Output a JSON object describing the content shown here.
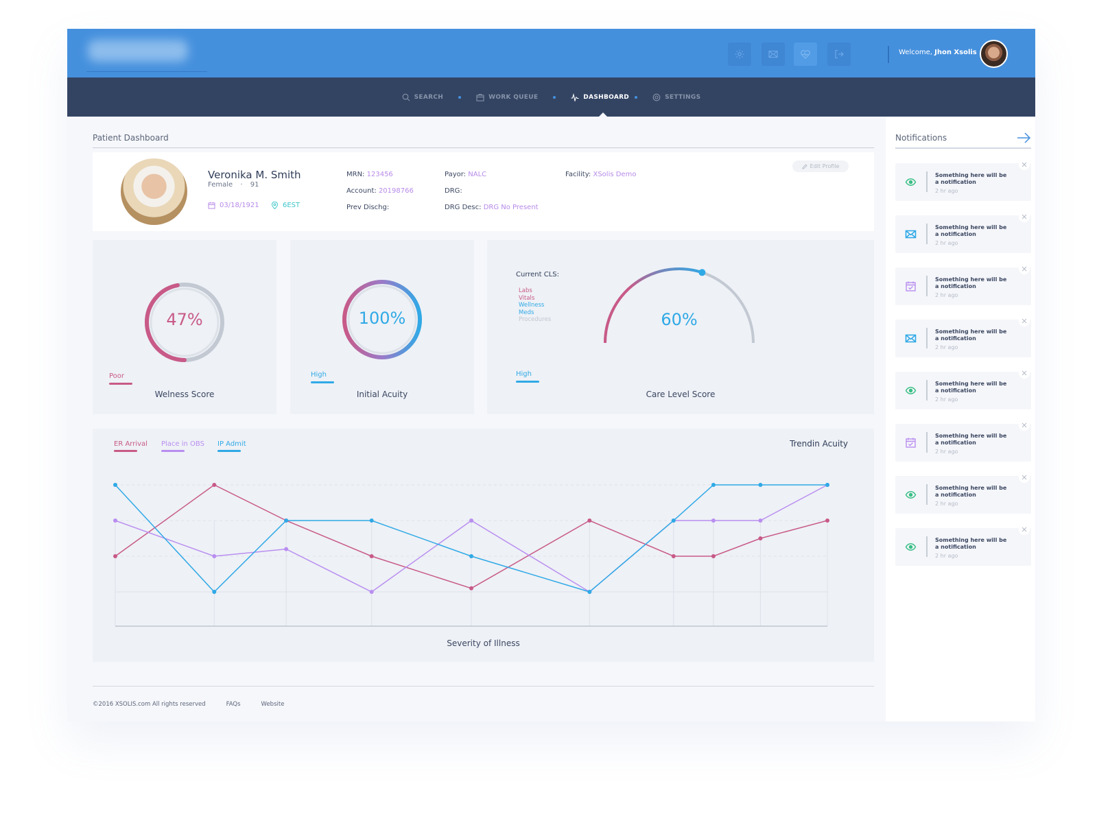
{
  "header": {
    "welcome_prefix": "Welcome, ",
    "user_name": "Jhon Xsolis",
    "icons": [
      "gear-icon",
      "mail-icon",
      "heart-pulse-icon",
      "logout-icon"
    ]
  },
  "nav": {
    "items": [
      {
        "label": "SEARCH",
        "icon": "search-icon",
        "active": false
      },
      {
        "label": "WORK QUEUE",
        "icon": "briefcase-icon",
        "active": false
      },
      {
        "label": "DASHBOARD",
        "icon": "pulse-icon",
        "active": true
      },
      {
        "label": "SETTINGS",
        "icon": "gear-icon",
        "active": false
      }
    ]
  },
  "page": {
    "title": "Patient Dashboard"
  },
  "patient": {
    "name": "Veronika M. Smith",
    "gender": "Female",
    "age": "91",
    "dob": "03/18/1921",
    "location": "6EST",
    "edit_label": "Edit Profile",
    "fields": [
      {
        "label": "MRN:",
        "value": "123456"
      },
      {
        "label": "Account:",
        "value": "20198766"
      },
      {
        "label": "Prev Dischg:",
        "value": ""
      },
      {
        "label": "Payor:",
        "value": "NALC"
      },
      {
        "label": "DRG:",
        "value": ""
      },
      {
        "label": "DRG Desc:",
        "value": "DRG No Present"
      },
      {
        "label": "Facility:",
        "value": "XSolis Demo"
      }
    ]
  },
  "scores": {
    "wellness": {
      "value_text": "47%",
      "fraction": 0.47,
      "level": "Poor",
      "label": "Welness Score"
    },
    "acuity": {
      "value_text": "100%",
      "fraction": 1.0,
      "level": "High",
      "label": "Initial Acuity"
    },
    "care": {
      "value_text": "60%",
      "fraction": 0.6,
      "level": "High",
      "label": "Care Level Score",
      "cls_title": "Current CLS:",
      "cls_items": [
        {
          "label": "Labs",
          "color": "#c85a88"
        },
        {
          "label": "Vitals",
          "color": "#c85a88"
        },
        {
          "label": "Wellness",
          "color": "#2fa9e6"
        },
        {
          "label": "Meds",
          "color": "#2fa9e6"
        },
        {
          "label": "Procedures",
          "color": "#c1c6cf"
        }
      ]
    }
  },
  "colors": {
    "pink": "#c85a88",
    "purple": "#b98ef0",
    "blue": "#2fa9e6",
    "header_blue": "#4590dd",
    "nav_dark": "#334463",
    "green": "#3bbf86"
  },
  "chart_data": {
    "type": "line",
    "title": "Trendin Acuity",
    "xlabel": "Severity of Illness",
    "ylabel": "",
    "x": [
      0,
      1,
      2,
      3,
      4,
      5,
      6,
      7,
      8,
      9
    ],
    "ylim": [
      0,
      4
    ],
    "grid": true,
    "legend": "top-left",
    "series": [
      {
        "name": "ER Arrival",
        "color": "#c85a88",
        "values": [
          2,
          4,
          3,
          2,
          1.1,
          3,
          2,
          2,
          2.5,
          3
        ]
      },
      {
        "name": "Place in OBS",
        "color": "#b98ef0",
        "values": [
          3,
          2,
          2.2,
          1,
          3,
          1,
          3,
          3,
          3,
          4
        ]
      },
      {
        "name": "IP Admit",
        "color": "#2fa9e6",
        "values": [
          4,
          1,
          3,
          3,
          2,
          1,
          3,
          4,
          4,
          4
        ]
      }
    ],
    "x_positions": [
      0,
      0.139,
      0.24,
      0.36,
      0.5,
      0.666,
      0.784,
      0.84,
      0.906,
      1.0
    ]
  },
  "notifications": {
    "title": "Notifications",
    "items": [
      {
        "icon": "eye-icon",
        "text": "Something here will be a notification",
        "time": "2 hr ago"
      },
      {
        "icon": "mail-icon",
        "text": "Something here will be a notification",
        "time": "2 hr ago"
      },
      {
        "icon": "calendar-check-icon",
        "text": "Something here will be a notification",
        "time": "2 hr ago"
      },
      {
        "icon": "mail-icon",
        "text": "Something here will be a notification",
        "time": "2 hr ago"
      },
      {
        "icon": "eye-icon",
        "text": "Something here will be a notification",
        "time": "2 hr ago"
      },
      {
        "icon": "calendar-check-icon",
        "text": "Something here will be a notification",
        "time": "2 hr ago"
      },
      {
        "icon": "eye-icon",
        "text": "Something here will be a notification",
        "time": "2 hr ago"
      },
      {
        "icon": "eye-icon",
        "text": "Something here will be a notification",
        "time": "2 hr ago"
      }
    ]
  },
  "footer": {
    "copyright": "©2016 XSOLIS.com All rights reserved",
    "links": [
      "FAQs",
      "Website"
    ]
  }
}
